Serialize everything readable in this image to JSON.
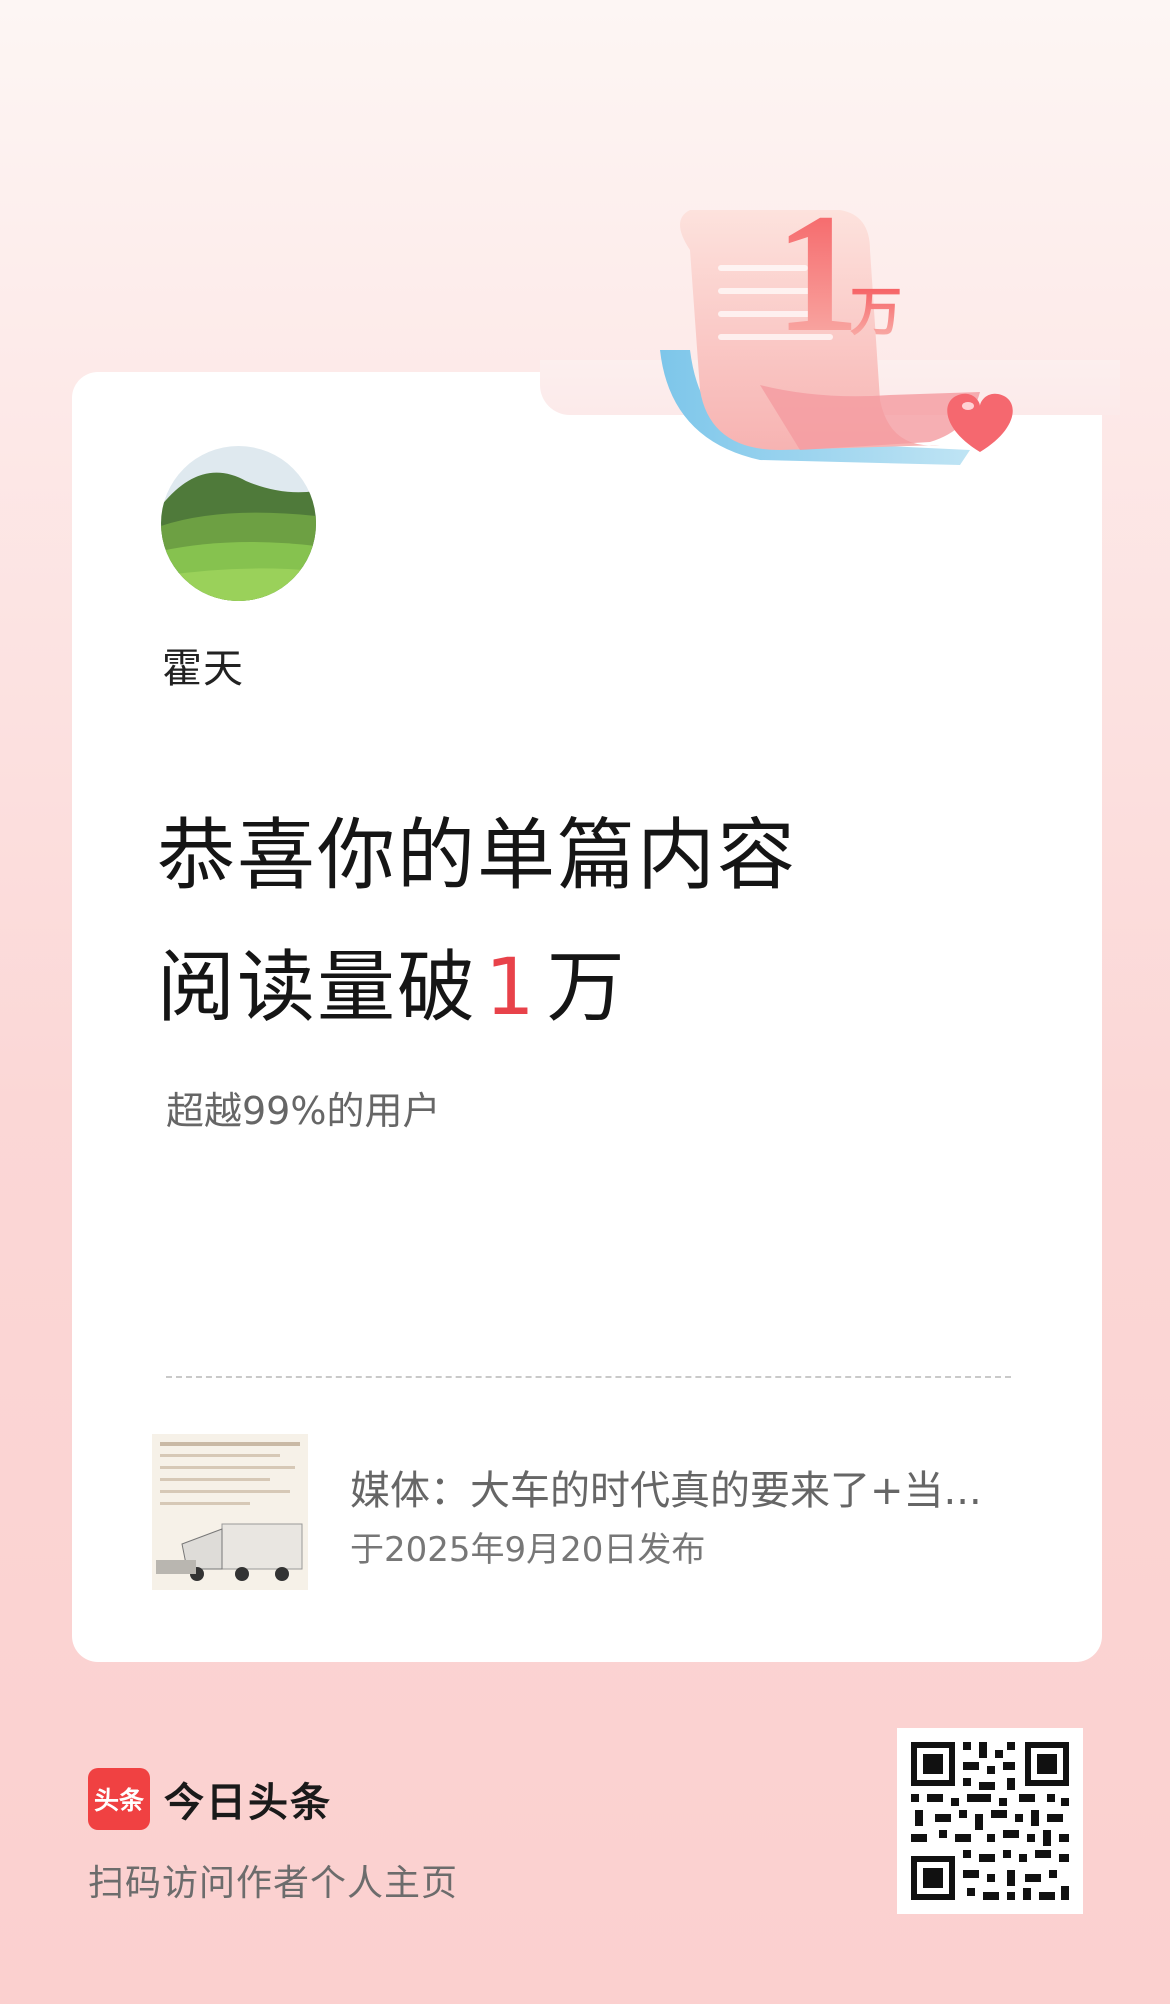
{
  "author": {
    "name": "霍天"
  },
  "milestone": {
    "badge_number": "1",
    "badge_unit": "万",
    "headline_line1": "恭喜你的单篇内容",
    "headline_line2_prefix": "阅读量破",
    "headline_number": "1",
    "headline_unit": "万",
    "subline": "超越99%的用户",
    "accent_color": "#e8424a"
  },
  "article": {
    "title": "媒体：大车的时代真的要来了+当...",
    "date": "于2025年9月20日发布"
  },
  "footer": {
    "brand_logo_text": "头条",
    "brand_name": "今日头条",
    "scan_text": "扫码访问作者个人主页"
  },
  "icons": [
    "milestone-badge-icon",
    "heart-icon",
    "qr-code-icon"
  ]
}
